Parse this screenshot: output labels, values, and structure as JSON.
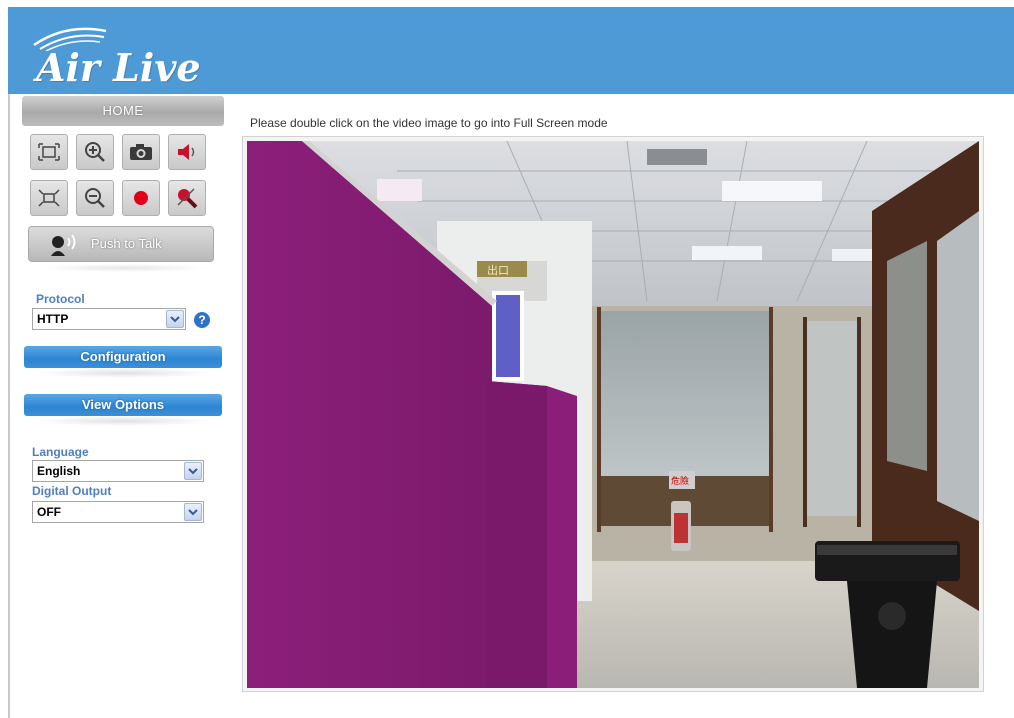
{
  "header": {
    "logo_text": "Air Live"
  },
  "sidebar": {
    "home_tab": "HOME",
    "controls_row1": [
      "fit-screen-icon",
      "zoom-in-icon",
      "snapshot-icon",
      "speaker-icon"
    ],
    "controls_row2": [
      "actual-size-icon",
      "zoom-out-icon",
      "record-icon",
      "microphone-mute-icon"
    ],
    "push_to_talk": "Push to Talk",
    "protocol": {
      "label": "Protocol",
      "value": "HTTP"
    },
    "configuration_label": "Configuration",
    "view_options_label": "View Options",
    "language": {
      "label": "Language",
      "value": "English"
    },
    "digital_output": {
      "label": "Digital Output",
      "value": "OFF"
    }
  },
  "main": {
    "hint": "Please double click on the video image to go into Full Screen mode",
    "video_scene_text": {
      "exit_sign": "出口",
      "door_sign": "危險"
    }
  },
  "colors": {
    "header_blue": "#4e9ad6",
    "bar_blue": "#2d86d2",
    "label_blue": "#4e7fc0",
    "partition_purple": "#8a1e78"
  }
}
